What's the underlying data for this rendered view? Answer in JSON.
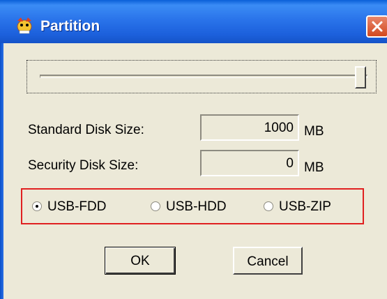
{
  "window": {
    "title": "Partition",
    "icon": "app-icon",
    "close_icon": "close-icon"
  },
  "slider": {
    "position_fraction": 1.0
  },
  "fields": [
    {
      "label": "Standard Disk Size:",
      "value": "1000",
      "unit": "MB"
    },
    {
      "label": "Security Disk Size:",
      "value": "0",
      "unit": "MB"
    }
  ],
  "radio_options": [
    {
      "label": "USB-FDD",
      "selected": true
    },
    {
      "label": "USB-HDD",
      "selected": false
    },
    {
      "label": "USB-ZIP",
      "selected": false
    }
  ],
  "colors": {
    "title_bar": "#2a74ea",
    "dialog_bg": "#ece9d8",
    "highlight_box": "#e02020",
    "close_button": "#d2491f"
  },
  "buttons": {
    "ok_label": "OK",
    "cancel_label": "Cancel"
  }
}
